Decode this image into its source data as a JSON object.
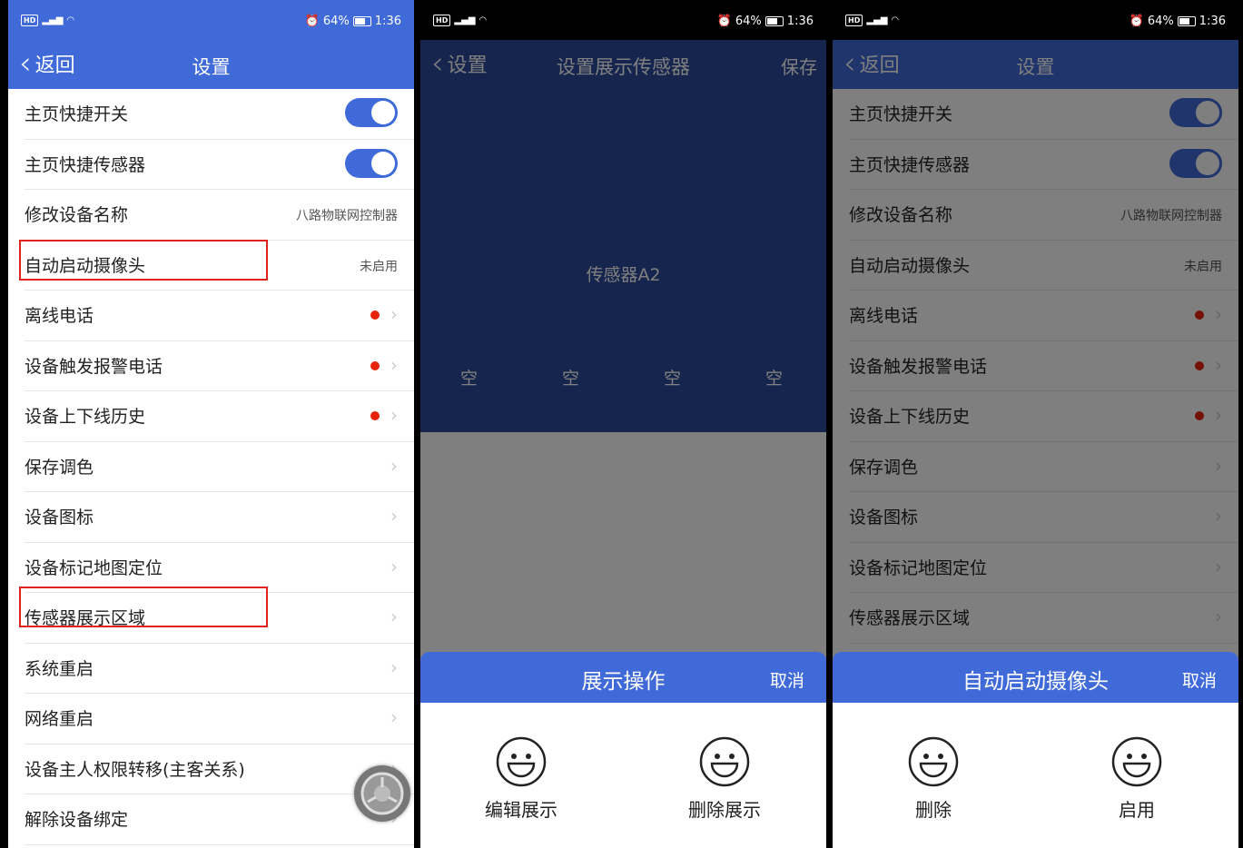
{
  "status": {
    "signal": "46",
    "battery": "64%",
    "time": "1:36"
  },
  "screen1": {
    "back": "返回",
    "title": "设置",
    "rows": [
      {
        "label": "主页快捷开关",
        "kind": "toggle"
      },
      {
        "label": "主页快捷传感器",
        "kind": "toggle"
      },
      {
        "label": "修改设备名称",
        "kind": "value",
        "value": "八路物联网控制器"
      },
      {
        "label": "自动启动摄像头",
        "kind": "value",
        "value": "未启用"
      },
      {
        "label": "离线电话",
        "kind": "dot"
      },
      {
        "label": "设备触发报警电话",
        "kind": "dot"
      },
      {
        "label": "设备上下线历史",
        "kind": "dot"
      },
      {
        "label": "保存调色",
        "kind": "arrow"
      },
      {
        "label": "设备图标",
        "kind": "arrow"
      },
      {
        "label": "设备标记地图定位",
        "kind": "arrow"
      },
      {
        "label": "传感器展示区域",
        "kind": "arrow"
      },
      {
        "label": "系统重启",
        "kind": "arrow"
      },
      {
        "label": "网络重启",
        "kind": "arrow"
      },
      {
        "label": "设备主人权限转移(主客关系)",
        "kind": "arrow"
      },
      {
        "label": "解除设备绑定",
        "kind": "arrow"
      }
    ]
  },
  "screen2": {
    "back": "设置",
    "title": "设置展示传感器",
    "save": "保存",
    "sensor_name": "传感器A2",
    "slots": [
      "空",
      "空",
      "空",
      "空"
    ],
    "sheet": {
      "title": "展示操作",
      "cancel": "取消",
      "actions": [
        "编辑展示",
        "删除展示"
      ]
    }
  },
  "screen3": {
    "back": "返回",
    "title": "设置",
    "sheet": {
      "title": "自动启动摄像头",
      "cancel": "取消",
      "actions": [
        "删除",
        "启用"
      ]
    }
  },
  "colors": {
    "primary": "#3f6ad8",
    "highlight": "#e0231f",
    "dot": "#e8230a"
  }
}
